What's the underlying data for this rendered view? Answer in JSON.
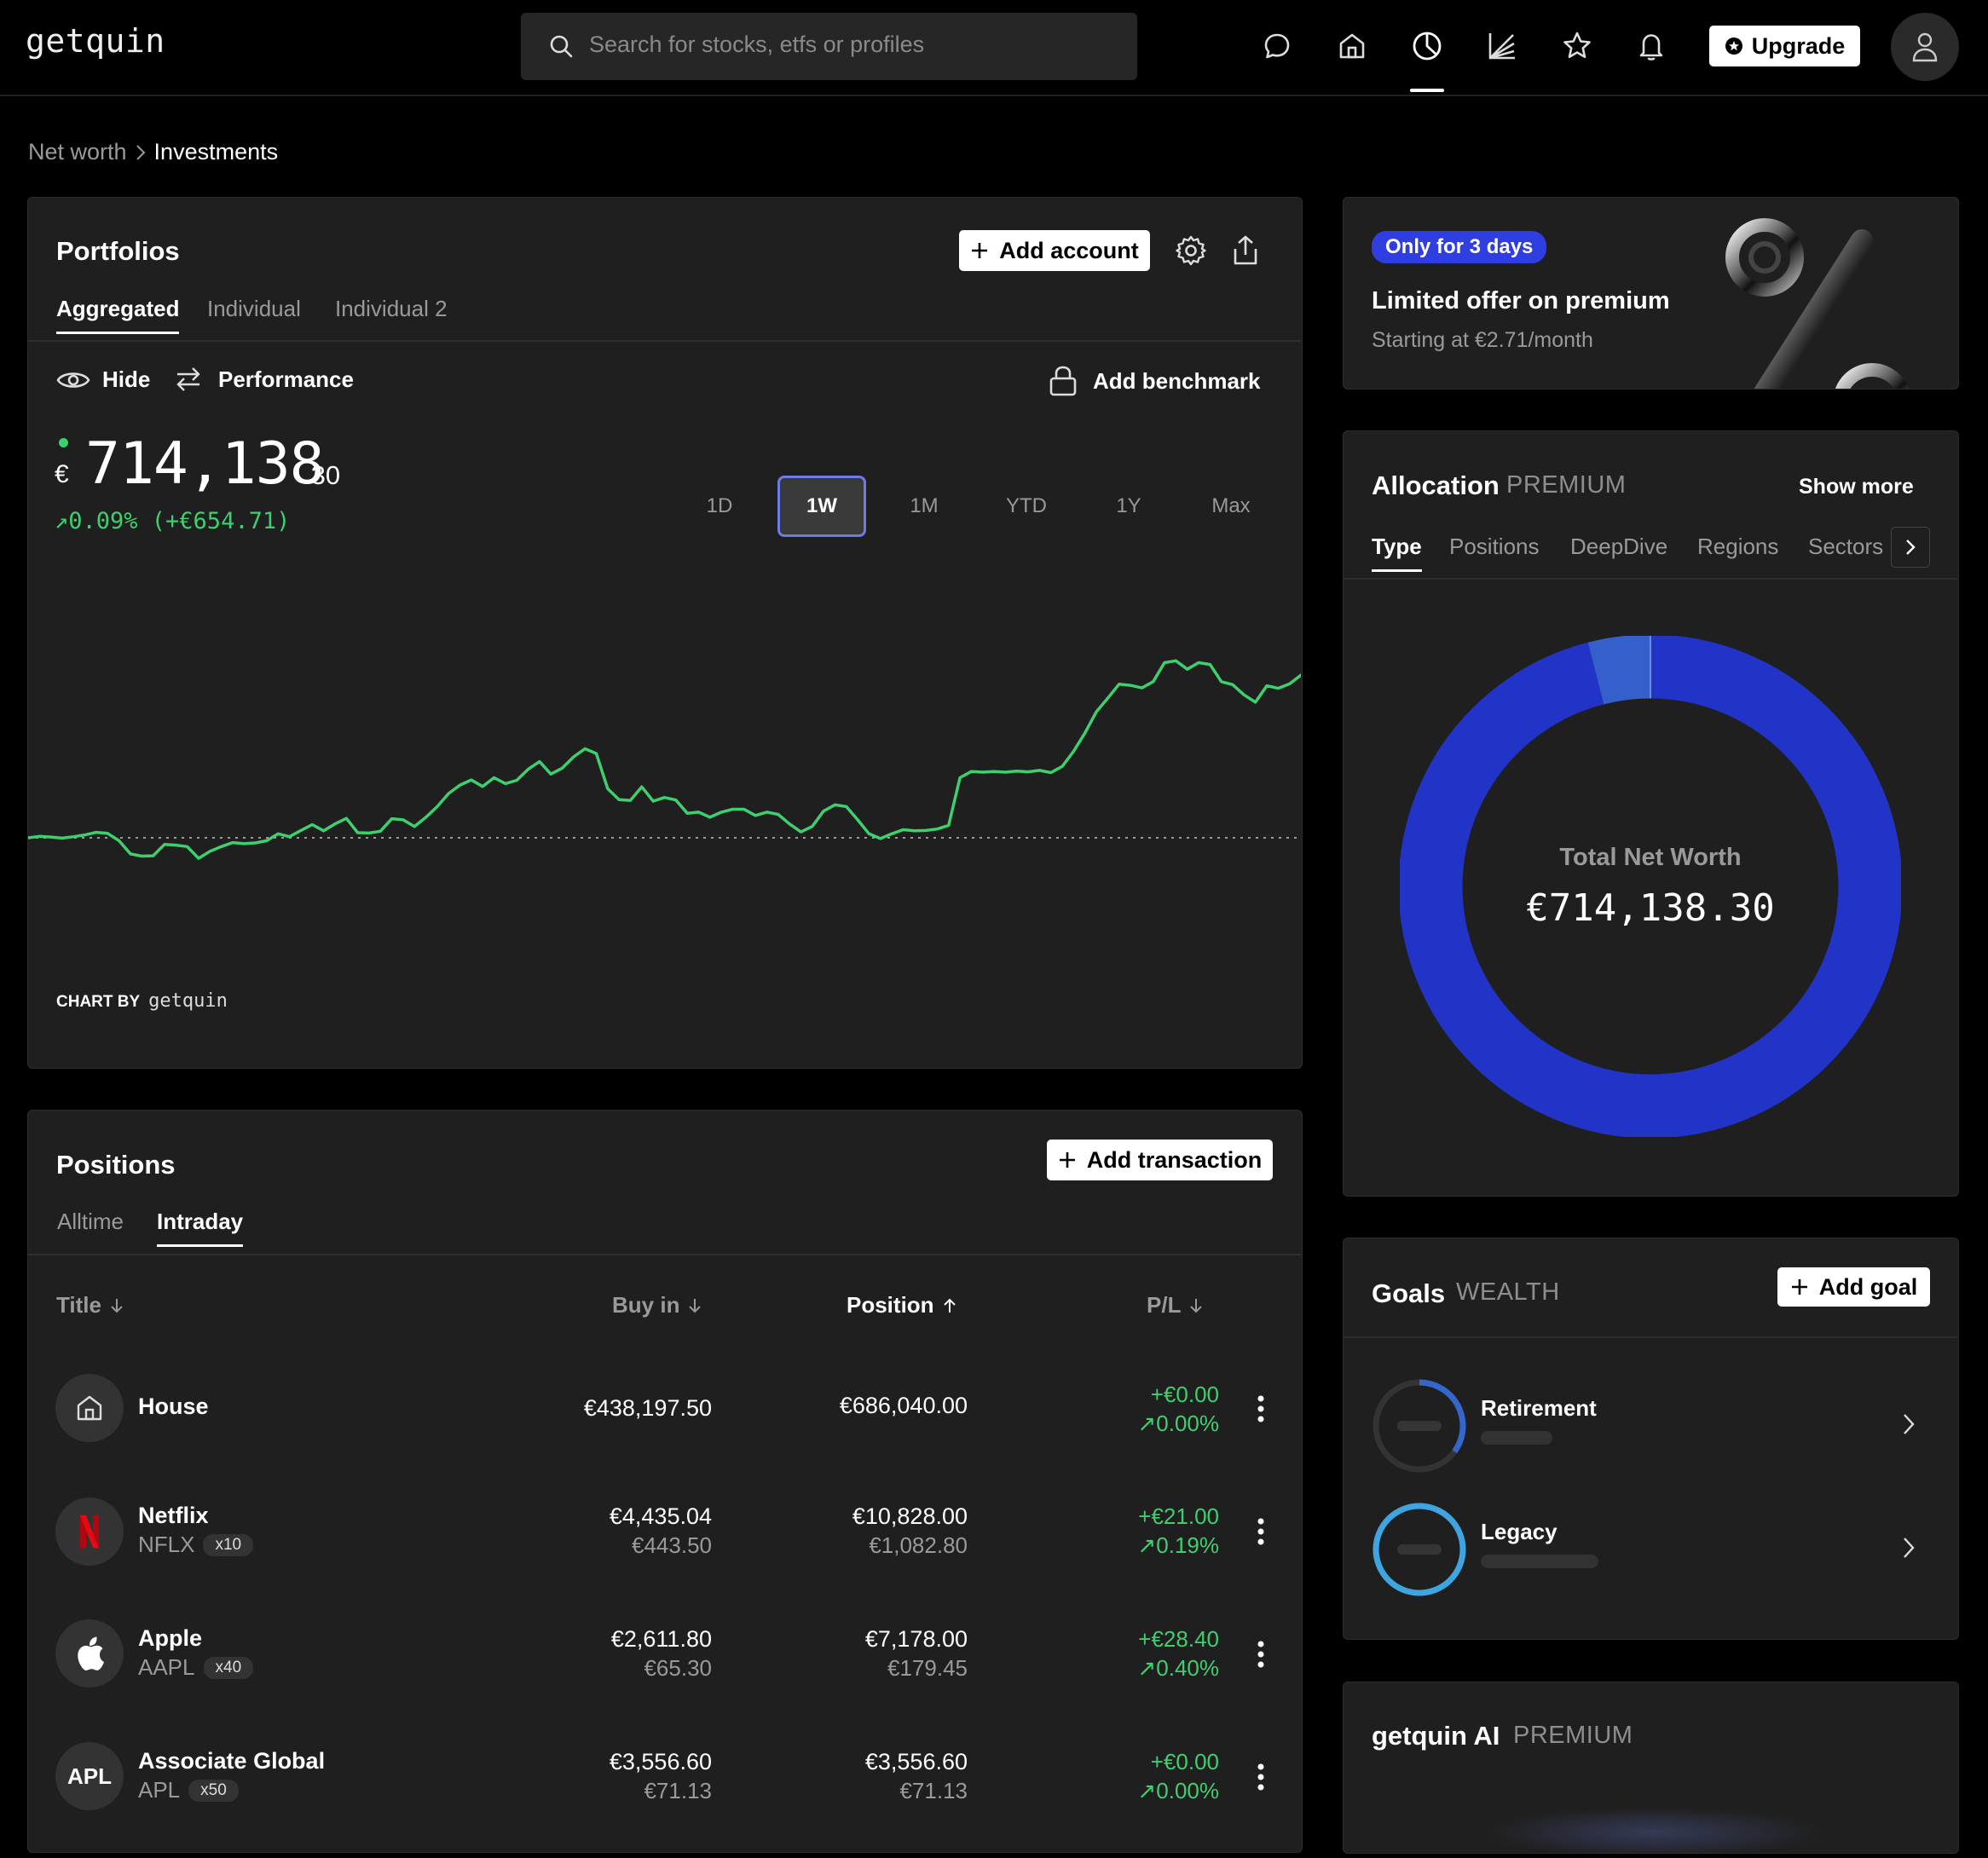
{
  "app": {
    "logo": "getquin",
    "search_placeholder": "Search for stocks, etfs or profiles",
    "upgrade_label": "Upgrade"
  },
  "breadcrumb": {
    "parent": "Net worth",
    "current": "Investments"
  },
  "portfolios": {
    "title": "Portfolios",
    "add_account_label": "Add account",
    "tabs": [
      "Aggregated",
      "Individual",
      "Individual 2"
    ],
    "active_tab": "Aggregated",
    "hide_label": "Hide",
    "performance_label": "Performance",
    "benchmark_label": "Add benchmark",
    "currency": "€",
    "value_main": "714,138",
    "value_cents": ".30",
    "change": "↗0.09% (+€654.71)",
    "ranges": [
      "1D",
      "1W",
      "1M",
      "YTD",
      "1Y",
      "Max"
    ],
    "active_range": "1W",
    "chart_by_label": "CHART BY",
    "chart_by_brand": "getquin",
    "accent_color": "#3ecf6e"
  },
  "chart_data": {
    "type": "line",
    "series_color": "#3ecf6e",
    "baseline_value": 0,
    "values": [
      0,
      0.4,
      0.2,
      -0.1,
      0.3,
      0.8,
      1.5,
      1.2,
      -0.8,
      -4.4,
      -5.0,
      -4.9,
      -1.8,
      -2.0,
      -2.4,
      -5.6,
      -3.7,
      -2.4,
      -1.3,
      -1.6,
      -1.4,
      -0.8,
      1.1,
      0.3,
      2.0,
      3.6,
      1.9,
      3.8,
      5.3,
      1.4,
      1.3,
      1.8,
      5.2,
      4.9,
      3.1,
      5.6,
      8.5,
      12.1,
      14.4,
      15.8,
      14.0,
      16.4,
      14.8,
      15.7,
      18.7,
      20.8,
      17.4,
      19.0,
      22.1,
      24.3,
      23.0,
      13.4,
      10.4,
      10.2,
      13.9,
      10.0,
      11.0,
      10.3,
      6.7,
      7.0,
      5.6,
      7.0,
      7.8,
      7.8,
      6.1,
      7.0,
      6.4,
      3.8,
      1.6,
      3.1,
      7.3,
      9.0,
      8.5,
      4.9,
      1.1,
      -0.2,
      1.1,
      2.2,
      1.9,
      2.0,
      2.4,
      3.4,
      16.4,
      18.1,
      17.9,
      18.1,
      17.9,
      18.2,
      18.0,
      18.4,
      17.8,
      19.5,
      23.6,
      28.6,
      34.4,
      38.1,
      41.9,
      41.6,
      40.9,
      42.6,
      47.8,
      48.3,
      46.0,
      47.8,
      47.3,
      42.6,
      41.8,
      39.0,
      37.0,
      41.5,
      40.8,
      42.0,
      44.4
    ]
  },
  "positions": {
    "title": "Positions",
    "add_transaction_label": "Add transaction",
    "tabs": [
      "Alltime",
      "Intraday"
    ],
    "active_tab": "Intraday",
    "columns": [
      "Title",
      "Buy in",
      "Position",
      "P/L"
    ],
    "rows": [
      {
        "title": "House",
        "ticker": "",
        "qty": "",
        "icon": "house-icon",
        "buy_in": "€438,197.50",
        "buy_in_unit": "",
        "position": "€686,040.00",
        "position_unit": "",
        "pl_abs": "+€0.00",
        "pl_pct": "↗0.00%"
      },
      {
        "title": "Netflix",
        "ticker": "NFLX",
        "qty": "x10",
        "icon": "netflix-logo-icon",
        "buy_in": "€4,435.04",
        "buy_in_unit": "€443.50",
        "position": "€10,828.00",
        "position_unit": "€1,082.80",
        "pl_abs": "+€21.00",
        "pl_pct": "↗0.19%"
      },
      {
        "title": "Apple",
        "ticker": "AAPL",
        "qty": "x40",
        "icon": "apple-logo-icon",
        "buy_in": "€2,611.80",
        "buy_in_unit": "€65.30",
        "position": "€7,178.00",
        "position_unit": "€179.45",
        "pl_abs": "+€28.40",
        "pl_pct": "↗0.40%"
      },
      {
        "title": "Associate Global",
        "ticker": "APL",
        "qty": "x50",
        "icon_text": "APL",
        "buy_in": "€3,556.60",
        "buy_in_unit": "€71.13",
        "position": "€3,556.60",
        "position_unit": "€71.13",
        "pl_abs": "+€0.00",
        "pl_pct": "↗0.00%"
      }
    ]
  },
  "promo": {
    "badge": "Only for 3 days",
    "title": "Limited offer on premium",
    "subtitle": "Starting at €2.71/month"
  },
  "allocation": {
    "title": "Allocation",
    "badge": "PREMIUM",
    "show_more": "Show more",
    "tabs": [
      "Type",
      "Positions",
      "DeepDive",
      "Regions",
      "Sectors"
    ],
    "active_tab": "Type",
    "center_label": "Total Net Worth",
    "center_value": "€714,138.30",
    "segments": [
      {
        "fraction": 0.96,
        "color": "#2233c8"
      },
      {
        "fraction": 0.04,
        "color": "#3560cc"
      }
    ]
  },
  "goals": {
    "title": "Goals",
    "badge": "WEALTH",
    "add_label": "Add goal",
    "items": [
      {
        "name": "Retirement",
        "progress": 0.35,
        "ring_color": "#3566c9"
      },
      {
        "name": "Legacy",
        "progress": 1.0,
        "ring_color": "#3ea5e0"
      }
    ]
  },
  "ai": {
    "title": "getquin AI",
    "badge": "PREMIUM"
  }
}
